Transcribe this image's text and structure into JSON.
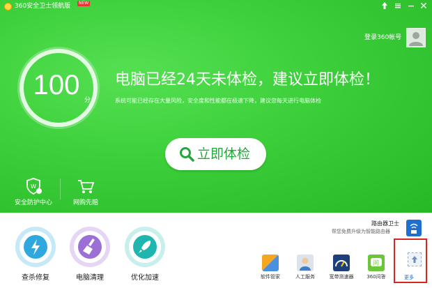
{
  "app": {
    "title": "360安全卫士领航版",
    "badge": "NEW"
  },
  "window": {
    "icons": [
      "up-arrow-icon",
      "menu-icon",
      "minimize-icon",
      "close-icon"
    ]
  },
  "account": {
    "login": "登录360帐号"
  },
  "score": {
    "value": "100",
    "unit": "分"
  },
  "headline": "电脑已经24天未体检，建议立即体检！",
  "subline": "系统可能已经存在大量风险，安全度和性能都在极速下降，建议您每天进行电脑体检",
  "check_button": "立即体检",
  "features": [
    {
      "label": "安全防护中心",
      "icon": "shield-icon"
    },
    {
      "label": "网购先赔",
      "icon": "cart-icon"
    }
  ],
  "main_actions": [
    {
      "label": "查杀修复",
      "icon": "lightning-icon",
      "color": "#2fa8e0"
    },
    {
      "label": "电脑清理",
      "icon": "broom-icon",
      "color": "#9b6fd6"
    },
    {
      "label": "优化加速",
      "icon": "rocket-icon",
      "color": "#20b6b0"
    }
  ],
  "router": {
    "title": "路由器卫士",
    "subtitle": "帮您免费升级为智能路由器"
  },
  "tools": [
    {
      "label": "软件管家",
      "icon": "apps-icon"
    },
    {
      "label": "人工服务",
      "icon": "support-agent-icon"
    },
    {
      "label": "宽带测速器",
      "icon": "speed-test-icon"
    },
    {
      "label": "360问答",
      "icon": "qa-icon"
    }
  ],
  "more": {
    "label": "更多"
  },
  "colors": {
    "green": "#3ccf3a",
    "accent_green": "#22a83a",
    "highlight_red": "#d9261c",
    "blue": "#1f6fd1"
  }
}
